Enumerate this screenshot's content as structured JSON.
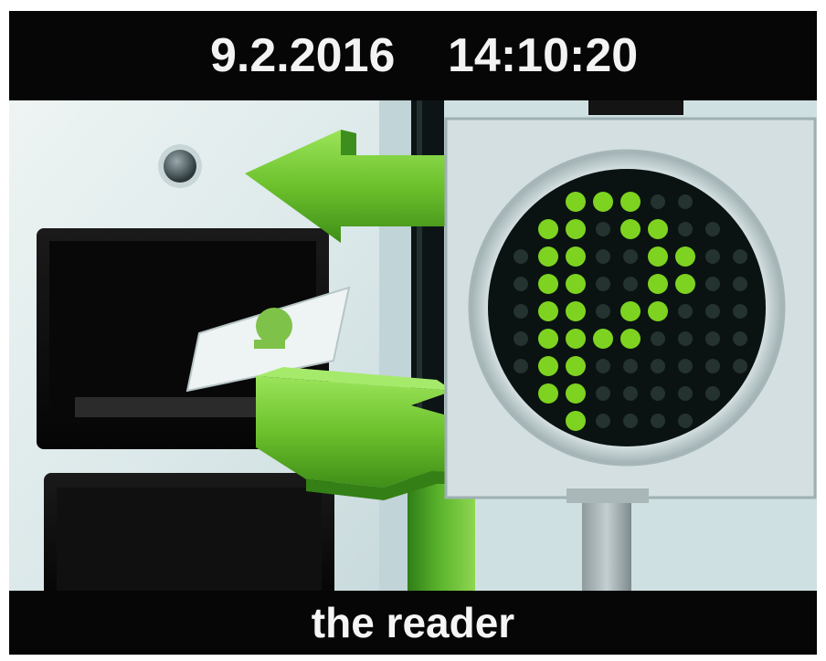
{
  "status_bar": {
    "date": "9.2.2016",
    "time": "14:10:20"
  },
  "scene": {
    "description_icon": "parking-reader-illustration",
    "sign_icon": "parking-p-led-icon",
    "arrow_icon": "green-arrow-icon",
    "accent_color": "#7ed321"
  },
  "caption": {
    "text": "the reader"
  }
}
